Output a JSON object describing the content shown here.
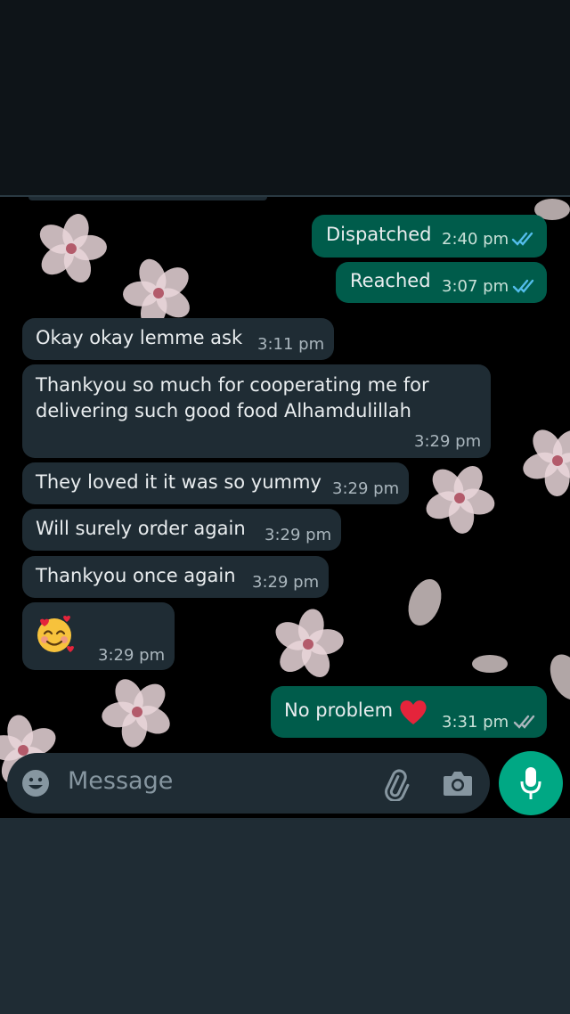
{
  "messages": [
    {
      "direction": "out",
      "text": "Dispatched",
      "time": "2:40 pm",
      "status": "read"
    },
    {
      "direction": "out",
      "text": "Reached",
      "time": "3:07 pm",
      "status": "read"
    },
    {
      "direction": "in",
      "text": "Okay okay lemme ask",
      "time": "3:11 pm"
    },
    {
      "direction": "in",
      "text": "Thankyou so much for cooperating me for delivering such good food Alhamdulillah",
      "time": "3:29 pm"
    },
    {
      "direction": "in",
      "text": "They loved it it was so yummy",
      "time": "3:29 pm"
    },
    {
      "direction": "in",
      "text": "Will surely order again",
      "time": "3:29 pm"
    },
    {
      "direction": "in",
      "text": "Thankyou once again",
      "time": "3:29 pm"
    },
    {
      "direction": "in",
      "emoji": "smiling-face-with-hearts",
      "time": "3:29 pm"
    },
    {
      "direction": "out",
      "text": "No problem",
      "emoji": "red-heart",
      "time": "3:31 pm",
      "status": "delivered"
    }
  ],
  "composer": {
    "placeholder": "Message",
    "icons": [
      "smiley-icon",
      "attachment-icon",
      "camera-icon",
      "microphone-icon"
    ]
  },
  "colors": {
    "incoming_bubble": "#1f2c34",
    "outgoing_bubble": "#005c4b",
    "accent": "#00a884",
    "read_ticks": "#53bdeb",
    "delivered_ticks": "#aab6bd"
  }
}
